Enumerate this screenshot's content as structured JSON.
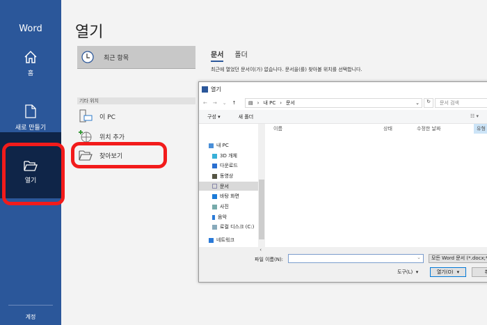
{
  "sidebar": {
    "app": "Word",
    "home": "홈",
    "new": "새로 만들기",
    "open": "열기",
    "account": "계정"
  },
  "main": {
    "title": "열기",
    "recent": "최근 항목",
    "other_section": "기타 위치",
    "this_pc": "이 PC",
    "add_place": "위치 추가",
    "browse": "찾아보기",
    "tabs": [
      "문서",
      "폴더"
    ],
    "message": "최근에 열었던 문서이(가) 없습니다. 문서을(를) 찾아볼 위치를 선택합니다."
  },
  "dialog": {
    "title": "열기",
    "path": [
      "내 PC",
      "문서"
    ],
    "search_placeholder": "문서 검색",
    "organize": "구성 ▾",
    "new_folder": "새 폴더",
    "nav": [
      "내 PC",
      "3D 개체",
      "다운로드",
      "동영상",
      "문서",
      "바탕 화면",
      "사진",
      "음악",
      "로컬 디스크 (C:)",
      "네트워크"
    ],
    "columns": [
      "이름",
      "상태",
      "수정한 날짜",
      "유형"
    ],
    "filename_label": "파일 이름(N):",
    "filename_value": "",
    "filetype": "모든 Word 문서 (*.docx;*.docm",
    "tools": "도구(L)",
    "open": "열기(O)",
    "cancel": "취"
  },
  "colors": {
    "sidebar": "#2b579a",
    "selected": "#0f2548",
    "highlight": "#f21b1b"
  }
}
